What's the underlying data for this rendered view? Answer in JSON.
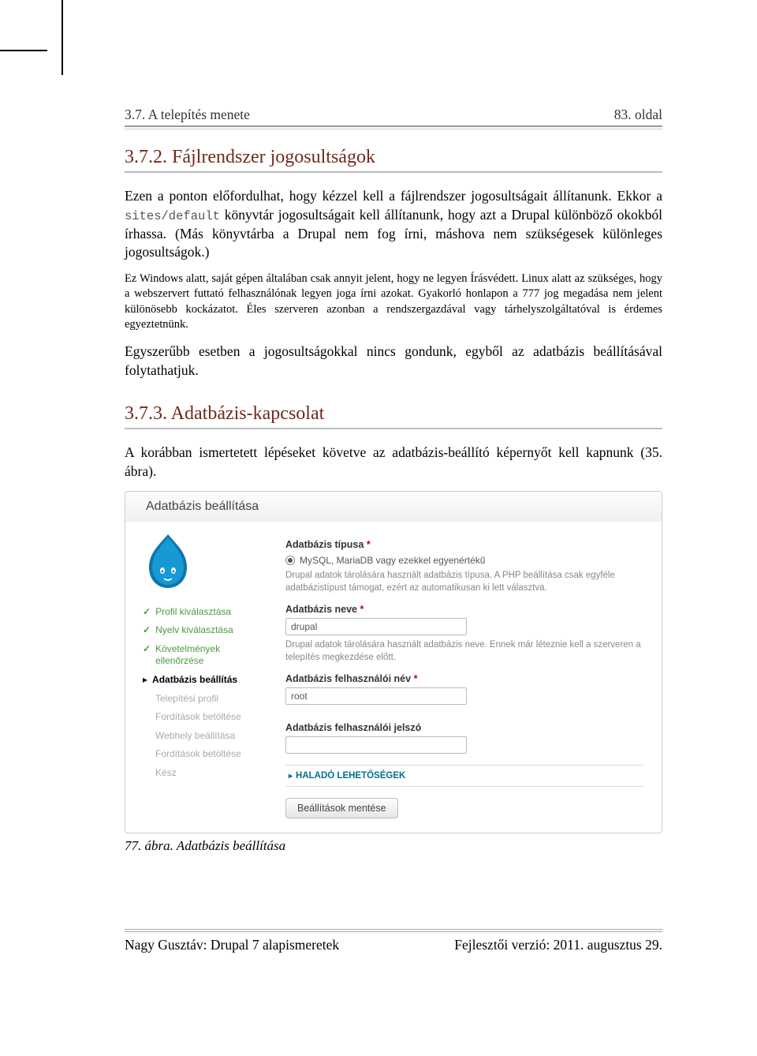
{
  "header": {
    "left": "3.7. A telepítés menete",
    "right": "83. oldal"
  },
  "section_372": {
    "title": "3.7.2. Fájlrendszer jogosultságok",
    "p1_pre": "Ezen a ponton előfordulhat, hogy kézzel kell a fájlrendszer jogosultságait állítanunk. Ekkor a ",
    "p1_code": "sites/default",
    "p1_post": " könyvtár jogosultságait kell állítanunk, hogy azt a Drupal különböző okokból írhassa. (Más könyvtárba a Drupal nem fog írni, máshova nem szükségesek különleges jogosultságok.)",
    "small1": "Ez Windows alatt, saját gépen általában csak annyit jelent, hogy ne legyen Írásvédett. Linux alatt az szükséges, hogy a webszervert futtató felhasználónak legyen joga írni azokat. Gyakorló honlapon a 777 jog megadása nem jelent különösebb kockázatot. Éles szerveren azonban a rendszergazdával vagy tárhelyszolgáltatóval is érdemes egyeztetnünk.",
    "p2": "Egyszerűbb esetben a jogosultságokkal nincs gondunk, egyből az adatbázis beállításával folytathatjuk."
  },
  "section_373": {
    "title": "3.7.3. Adatbázis-kapcsolat",
    "p1": "A korábban ismertetett lépéseket követve az adatbázis-beállító képernyőt kell kapnunk (35. ábra)."
  },
  "screenshot": {
    "panel_title": "Adatbázis beállítása",
    "steps": {
      "profil": "Profil kiválasztása",
      "nyelv": "Nyelv kiválasztása",
      "kovetelmenyek": "Követelmények ellenőrzése",
      "adatbazis": "Adatbázis beállítás",
      "tel_profil": "Telepítési profil",
      "ford1": "Fordítások betöltése",
      "webhely": "Webhely beállítása",
      "ford2": "Fordítások betöltése",
      "kesz": "Kész"
    },
    "form": {
      "db_type_label": "Adatbázis típusa",
      "db_type_option": "MySQL, MariaDB vagy ezekkel egyenértékű",
      "db_type_help": "Drupal adatok tárolására használt adatbázis típusa. A PHP beállítása csak egyféle adatbázistípust támogat, ezért az automatikusan ki lett választva.",
      "db_name_label": "Adatbázis neve",
      "db_name_value": "drupal",
      "db_name_help": "Drupal adatok tárolására használt adatbázis neve. Ennek már léteznie kell a szerveren a telepítés megkezdése előtt.",
      "db_user_label": "Adatbázis felhasználói név",
      "db_user_value": "root",
      "db_pass_label": "Adatbázis felhasználói jelszó",
      "db_pass_value": "",
      "advanced": "HALADÓ LEHETŐSÉGEK",
      "save": "Beállítások mentése"
    }
  },
  "caption": "77. ábra. Adatbázis beállítása",
  "footer": {
    "left": "Nagy Gusztáv: Drupal 7 alapismeretek",
    "right": "Fejlesztői verzió: 2011. augusztus 29."
  }
}
